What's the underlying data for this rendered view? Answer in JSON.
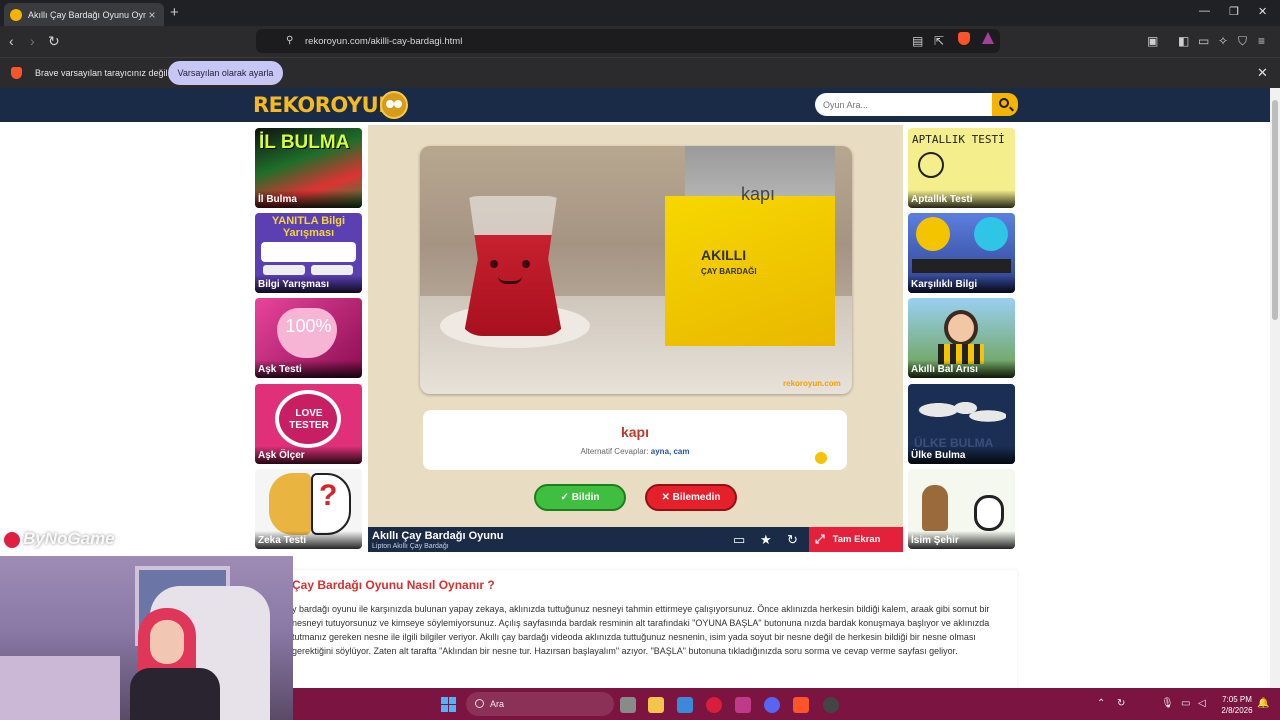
{
  "browser": {
    "tab_title": "Akıllı Çay Bardağı Oyunu Oyna",
    "url": "rekoroyun.com/akilli-cay-bardagi.html",
    "infobar_message": "Brave varsayılan tarayıcınız değil",
    "infobar_button": "Varsayılan olarak ayarla"
  },
  "site": {
    "logo_text": "REKOROYUN",
    "search_placeholder": "Oyun Ara..."
  },
  "left_games": [
    {
      "label": "İl Bulma",
      "art_text": "İL BULMA",
      "color": "#2f8f3a"
    },
    {
      "label": "Bilgi Yarışması",
      "art_text": "YANITLA Bilgi Yarışması",
      "color": "#5b3fb3"
    },
    {
      "label": "Aşk Testi",
      "art_text": "100%",
      "color": "#c31e7e"
    },
    {
      "label": "Aşk Ölçer",
      "art_text": "LOVE TESTER",
      "color": "#e0307a"
    },
    {
      "label": "Zeka Testi",
      "art_text": "?",
      "color": "#f0e7c4"
    }
  ],
  "right_games": [
    {
      "label": "Aptallık Testi",
      "art_text": "APTALLIK TESTİ",
      "color": "#f4ef8c"
    },
    {
      "label": "Karşılıklı Bilgi",
      "art_text": "",
      "color": "#3a5fc4"
    },
    {
      "label": "Akıllı Bal Arısı",
      "art_text": "",
      "color": "#6a9f4a"
    },
    {
      "label": "Ülke Bulma",
      "art_text": "ÜLKE BULMA",
      "color": "#1b2f55"
    },
    {
      "label": "İsim Şehir",
      "art_text": "",
      "color": "#d8ebc6"
    }
  ],
  "game": {
    "box_label": "kapı",
    "watermark": "rekoroyun.com",
    "answer": "kapı",
    "alt_label": "Alternatif Cevaplar:",
    "alt_values": "ayna, cam",
    "btn_correct": "✓ Bildin",
    "btn_wrong": "✕ Bilemedin",
    "title": "Akıllı Çay Bardağı Oyunu",
    "subtitle": "Lipton Akıllı Çay Bardağı",
    "fullscreen": "Tam Ekran"
  },
  "article": {
    "heading": "Çay Bardağı Oyunu Nasıl Oynanır ?",
    "body": "y bardağı oyunu ile karşınızda bulunan yapay zekaya, aklınızda tuttuğunuz nesneyi tahmin ettirmeye çalışıyorsunuz. Önce aklınızda herkesin bildiği kalem, araak gibi somut bir nesneyi tutuyorsunuz ve kimseye söylemiyorsunuz. Açılış sayfasında bardak resminin alt tarafındaki \"OYUNA BAŞLA\" butonuna nızda bardak konuşmaya başlıyor ve aklınızda tutmanız gereken nesne ile ilgili bilgiler veriyor. Akıllı çay bardağı videoda aklınızda tuttuğunuz nesnenin, isim yada soyut bir nesne değil de herkesin bildiği bir nesne olması gerektiğini söylüyor. Zaten alt tarafta \"Aklından bir nesne tur. Hazırsan başlayalım\" azıyor. \"BAŞLA\" butonuna tıkladığınızda soru sorma ve cevap verme sayfası geliyor."
  },
  "overlay": {
    "streamer_name": "ByNoGame"
  },
  "taskbar": {
    "search_text": "Ara",
    "time": "7:05 PM",
    "date": "2/8/2026"
  }
}
